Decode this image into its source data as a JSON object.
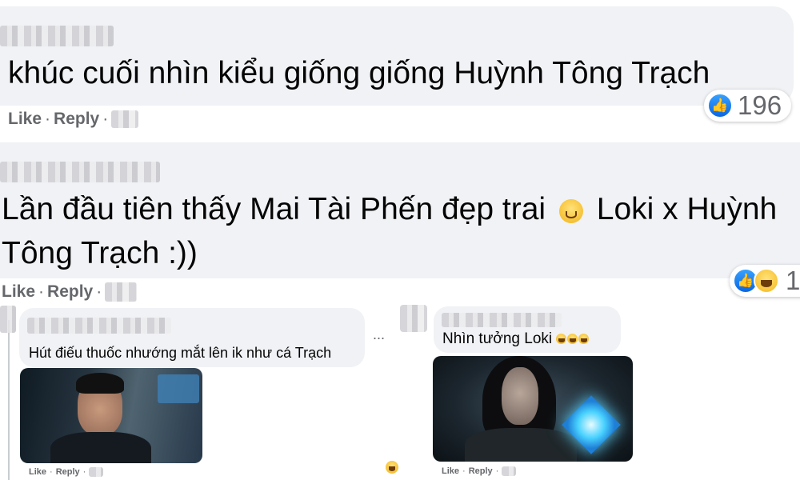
{
  "comment1": {
    "text": "khúc cuối nhìn kiểu giống giống Huỳnh Tông Trạch",
    "actions": {
      "like": "Like",
      "reply": "Reply"
    },
    "reaction_count": "196",
    "reaction_icons": [
      "like-icon"
    ]
  },
  "comment2": {
    "text_part1": "Lần đầu tiên thấy Mai Tài Phến đẹp trai",
    "text_part2": "Loki x Huỳnh Tông Trạch :))",
    "emoji": "smiling-face-icon",
    "actions": {
      "like": "Like",
      "reply": "Reply"
    },
    "reaction_count": "1",
    "reaction_icons": [
      "like-icon",
      "haha-icon"
    ]
  },
  "reply1": {
    "text": "Hút điếu thuốc nhướng mắt lên ik như cá Trạch",
    "more": "...",
    "actions": {
      "like": "Like",
      "reply": "Reply"
    }
  },
  "reply2": {
    "text": "Nhìn tưởng Loki",
    "emojis": [
      "laughing-face-icon",
      "laughing-face-icon",
      "laughing-face-icon"
    ],
    "actions": {
      "like": "Like",
      "reply": "Reply"
    }
  },
  "colors": {
    "bubble": "#f0f2f5",
    "action_text": "#65676b",
    "like_blue": "#1877f2"
  }
}
